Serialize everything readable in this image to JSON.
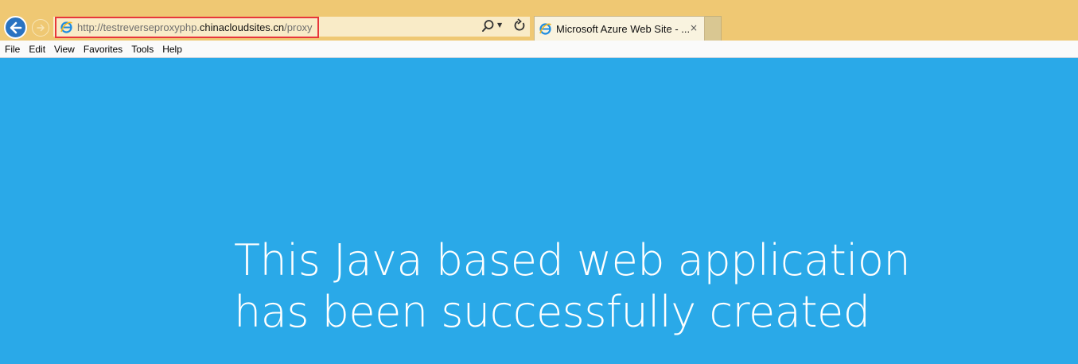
{
  "browser": {
    "address": {
      "prefix": "http://testreverseproxyphp.",
      "host": "chinacloudsites.cn",
      "suffix": "/proxy"
    },
    "tab": {
      "title": "Microsoft Azure Web Site - ...",
      "close": "×"
    },
    "menu": [
      "File",
      "Edit",
      "View",
      "Favorites",
      "Tools",
      "Help"
    ]
  },
  "page": {
    "headline_line1": "This Java based web application",
    "headline_line2": "has been successfully created"
  },
  "colors": {
    "page_background": "#2aa9e8",
    "chrome_background": "#efc873",
    "highlight_border": "#e8363a"
  },
  "icons": {
    "back": "back-arrow-icon",
    "forward": "forward-arrow-icon",
    "site": "internet-explorer-icon",
    "search": "search-icon",
    "dropdown": "dropdown-arrow-icon",
    "refresh": "refresh-icon",
    "close": "close-icon"
  }
}
